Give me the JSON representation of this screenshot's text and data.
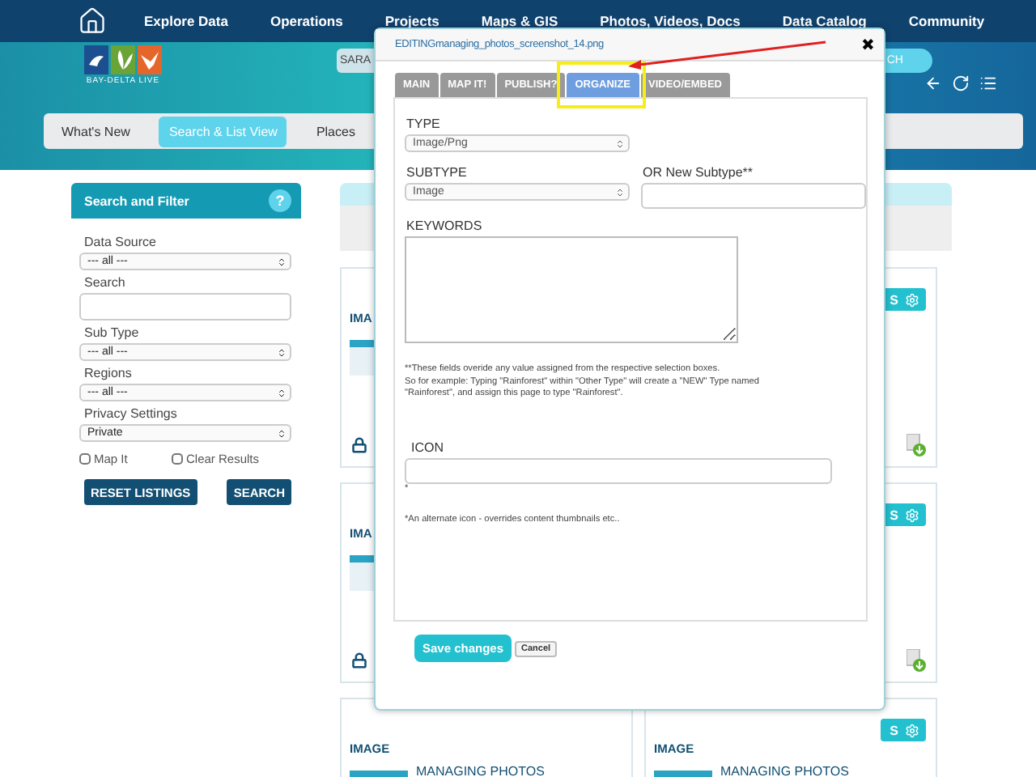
{
  "nav": {
    "items": [
      "Explore Data",
      "Operations",
      "Projects",
      "Maps & GIS",
      "Photos, Videos, Docs",
      "Data Catalog",
      "Community"
    ]
  },
  "header": {
    "logo_text": "BAY-DELTA LIVE",
    "search_value": "SARA",
    "search_button": "CH"
  },
  "subnav": [
    {
      "label": "What's New",
      "selected": false
    },
    {
      "label": "Search & List View",
      "selected": true
    },
    {
      "label": "Places",
      "selected": false
    }
  ],
  "sidebar": {
    "title": "Search and Filter",
    "help": "?",
    "fields": [
      {
        "kind": "select",
        "label": "Data Source",
        "value": "--- all ---"
      },
      {
        "kind": "input",
        "label": "Search"
      },
      {
        "kind": "select",
        "label": "Sub Type",
        "value": "--- all ---"
      },
      {
        "kind": "select",
        "label": "Regions",
        "value": "--- all ---"
      },
      {
        "kind": "select",
        "label": "Privacy Settings",
        "value": "Private"
      }
    ],
    "checkboxes": [
      {
        "label": "Map It",
        "checked": false
      },
      {
        "label": "Clear Results",
        "checked": false
      }
    ],
    "buttons": [
      "RESET LISTINGS",
      "SEARCH"
    ]
  },
  "cards": [
    {
      "heading": "IMA",
      "locked": true
    },
    {
      "button": "S",
      "download": true
    },
    {
      "heading": "IMA",
      "locked": true
    },
    {
      "button": "S",
      "download": true
    },
    {
      "heading": "IMAGE",
      "title": "MANAGING PHOTOS"
    },
    {
      "heading": "IMAGE",
      "title": "MANAGING PHOTOS",
      "button": "S"
    }
  ],
  "modal": {
    "title": "EDITINGmanaging_photos_screenshot_14.png",
    "close": "✖",
    "tabs": [
      {
        "label": "MAIN",
        "selected": false
      },
      {
        "label": "MAP IT!",
        "selected": false
      },
      {
        "label": "PUBLISH?",
        "selected": false
      },
      {
        "label": "ORGANIZE",
        "selected": true
      },
      {
        "label": "VIDEO/EMBED",
        "selected": false
      }
    ],
    "type_label": "TYPE",
    "type_value": "Image/Png",
    "subtype_label": "SUBTYPE",
    "subtype_value": "Image",
    "new_subtype_label": "OR New Subtype**",
    "keywords_label": "KEYWORDS",
    "note_lines": [
      "**These fields overide any value assigned from the respective selection boxes.",
      "So for example: Typing \"Rainforest\" within \"Other Type\" will create a \"NEW\" Type named \"Rainforest\", and assign this page to type \"Rainforest\"."
    ],
    "icon_label": "ICON",
    "icon_mark": "*",
    "icon_note": "*An alternate icon - overrides content thumbnails etc..",
    "save": "Save changes",
    "cancel": "Cancel"
  }
}
